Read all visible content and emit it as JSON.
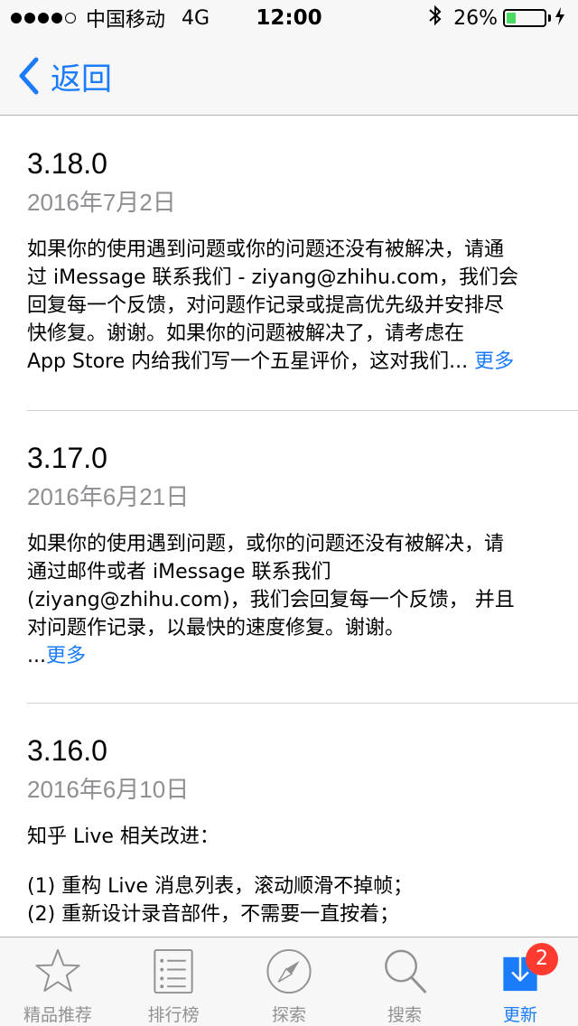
{
  "status_bar": {
    "carrier": "中国移动",
    "network": "4G",
    "time": "12:00",
    "battery_percent": "26%",
    "battery_level": 0.26,
    "battery_color": "#4cd964"
  },
  "nav": {
    "back_label": "返回",
    "back_icon": "chevron-left-icon",
    "accent_color": "#1a7cf9"
  },
  "versions": [
    {
      "version": "3.18.0",
      "date": "2016年7月2日",
      "notes_lines": [
        "如果你的使用遇到问题或你的问题还没有被解决，请通",
        "过 iMessage 联系我们 - ziyang@zhihu.com，我们会",
        "回复每一个反馈，对问题作记录或提高优先级并安排尽",
        "快修复。谢谢。如果你的问题被解决了，请考虑在",
        "App Store 内给我们写一个五星评价，这对我们..."
      ],
      "more_label": "更多"
    },
    {
      "version": "3.17.0",
      "date": "2016年6月21日",
      "notes_lines": [
        "如果你的使用遇到问题，或你的问题还没有被解决，请",
        "通过邮件或者 iMessage 联系我们",
        "(ziyang@zhihu.com)，我们会回复每一个反馈， 并且",
        "对问题作记录，以最快的速度修复。谢谢。",
        "..."
      ],
      "more_label": "更多"
    },
    {
      "version": "3.16.0",
      "date": "2016年6月10日",
      "notes_lines": [
        "知乎 Live 相关改进：",
        "",
        "(1) 重构 Live 消息列表，滚动顺滑不掉帧；",
        "(2) 重新设计录音部件，不需要一直按着；"
      ]
    }
  ],
  "tab_bar": {
    "tabs": [
      {
        "label": "精品推荐",
        "icon": "star-icon"
      },
      {
        "label": "排行榜",
        "icon": "list-icon"
      },
      {
        "label": "探索",
        "icon": "compass-icon"
      },
      {
        "label": "搜索",
        "icon": "search-icon"
      },
      {
        "label": "更新",
        "icon": "download-icon",
        "badge": "2"
      }
    ],
    "active_index": 4
  }
}
